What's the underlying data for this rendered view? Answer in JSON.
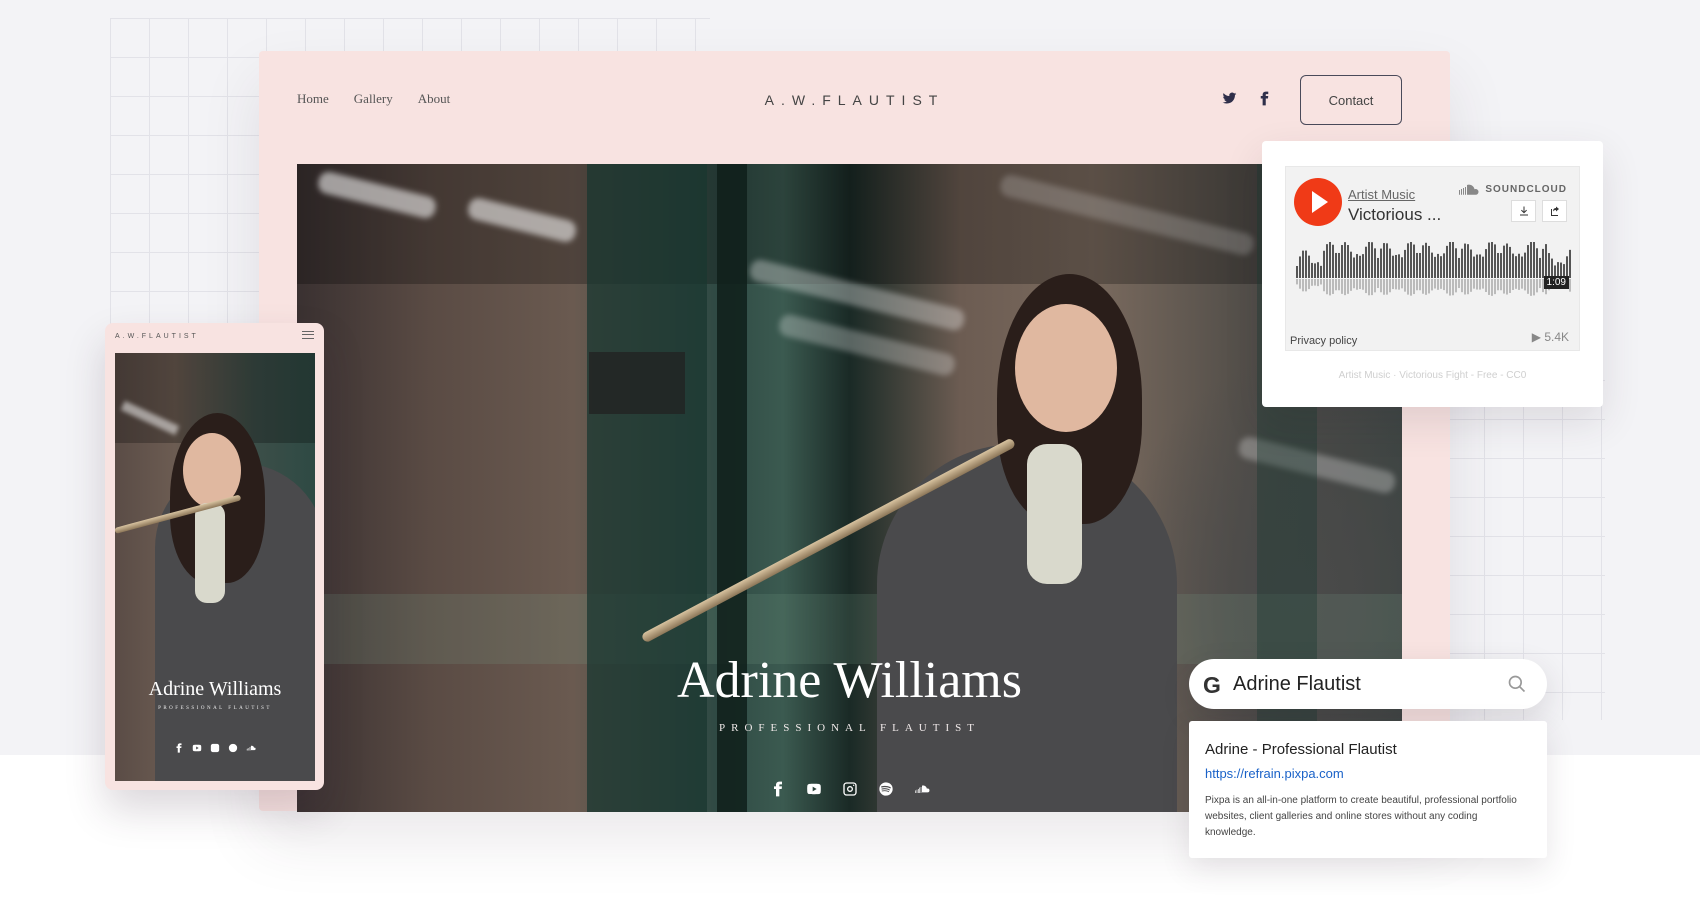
{
  "site": {
    "nav": [
      "Home",
      "Gallery",
      "About"
    ],
    "brand": "A.W.FLAUTIST",
    "contact_label": "Contact",
    "hero_title": "Adrine Williams",
    "hero_subtitle": "PROFESSIONAL FLAUTIST",
    "top_social_icons": [
      "twitter-icon",
      "facebook-icon"
    ],
    "hero_social_icons": [
      "facebook-icon",
      "youtube-icon",
      "instagram-icon",
      "spotify-icon",
      "soundcloud-icon"
    ]
  },
  "mobile": {
    "brand": "A.W.FLAUTIST",
    "title": "Adrine Williams",
    "subtitle": "PROFESSIONAL FLAUTIST"
  },
  "soundcloud": {
    "artist": "Artist Music",
    "track": "Victorious ...",
    "brand": "SOUNDCLOUD",
    "duration": "1:09",
    "privacy": "Privacy policy",
    "plays": "▶ 5.4K",
    "caption": "Artist Music · Victorious Fight - Free - CC0",
    "accent": "#f03a17"
  },
  "search": {
    "query": "Adrine Flautist",
    "result_title": "Adrine - Professional Flautist",
    "result_url": "https://refrain.pixpa.com",
    "result_desc": "Pixpa is an all-in-one platform to create beautiful, professional portfolio websites, client galleries and online stores without any coding knowledge."
  },
  "colors": {
    "site_background": "#f8e3e1",
    "link_blue": "#1a62c8"
  }
}
